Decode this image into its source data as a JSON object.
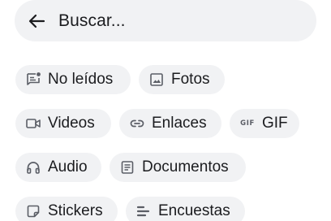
{
  "search": {
    "back_icon": "arrow-left-icon",
    "text": "Buscar..."
  },
  "filters": [
    {
      "label": "No leídos",
      "icon": "unread-chat-icon"
    },
    {
      "label": "Fotos",
      "icon": "image-icon"
    },
    {
      "label": "Videos",
      "icon": "video-icon"
    },
    {
      "label": "Enlaces",
      "icon": "link-icon"
    },
    {
      "label": "GIF",
      "icon": "gif-icon"
    },
    {
      "label": "Audio",
      "icon": "headphones-icon"
    },
    {
      "label": "Documentos",
      "icon": "document-icon"
    },
    {
      "label": "Stickers",
      "icon": "sticker-icon"
    },
    {
      "label": "Encuestas",
      "icon": "poll-icon"
    }
  ],
  "colors": {
    "chip_background": "#f1f2f4",
    "text": "#1b1c1f",
    "icon": "#5b5e66"
  }
}
